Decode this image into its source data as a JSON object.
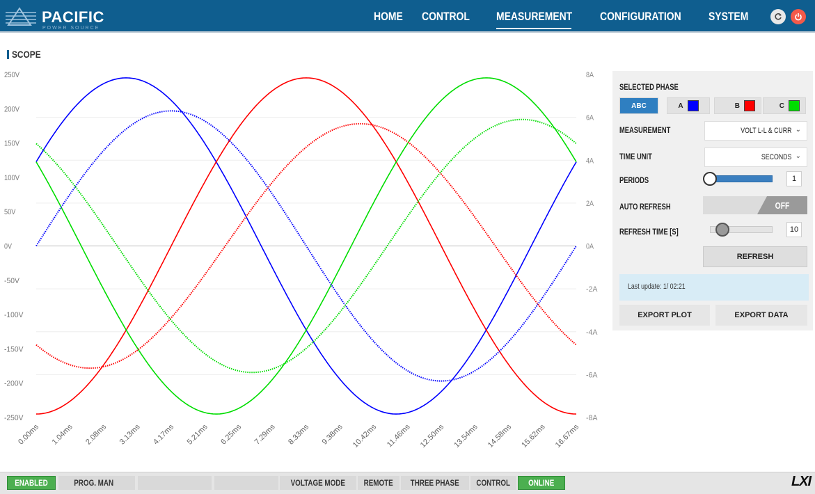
{
  "header": {
    "brand": "PACIFIC",
    "brand_sub": "POWER SOURCE",
    "nav": [
      "HOME",
      "CONTROL",
      "MEASUREMENT",
      "CONFIGURATION",
      "SYSTEM"
    ],
    "active_nav": "MEASUREMENT",
    "icons": [
      "refresh-icon",
      "power-icon"
    ]
  },
  "page": {
    "title": "SCOPE"
  },
  "chart_data": {
    "type": "line",
    "x_label": "",
    "x_ticks": [
      "0.00ms",
      "1.04ms",
      "2.08ms",
      "3.13ms",
      "4.17ms",
      "5.21ms",
      "6.25ms",
      "7.29ms",
      "8.33ms",
      "9.38ms",
      "10.42ms",
      "11.46ms",
      "12.50ms",
      "13.54ms",
      "14.58ms",
      "15.62ms",
      "16.67ms"
    ],
    "x_range_ms": [
      0,
      16.67
    ],
    "y_left_ticks": [
      "250V",
      "200V",
      "150V",
      "100V",
      "50V",
      "0V",
      "-50V",
      "-100V",
      "-150V",
      "-200V",
      "-250V"
    ],
    "y_left_range": [
      -250,
      250
    ],
    "y_right_ticks": [
      "8A",
      "6A",
      "4A",
      "2A",
      "0A",
      "-2A",
      "-4A",
      "-6A",
      "-8A"
    ],
    "y_right_range": [
      -8,
      8
    ],
    "grid": "horizontal",
    "series": [
      {
        "phase": "A",
        "kind": "voltage",
        "color": "#0000ff",
        "amplitude_V": 245,
        "phase_deg": 30,
        "style": "solid"
      },
      {
        "phase": "B",
        "kind": "voltage",
        "color": "#ff0000",
        "amplitude_V": 245,
        "phase_deg": -90,
        "style": "solid"
      },
      {
        "phase": "C",
        "kind": "voltage",
        "color": "#00dd00",
        "amplitude_V": 245,
        "phase_deg": 150,
        "style": "solid"
      },
      {
        "phase": "A",
        "kind": "current",
        "color": "#0000ff",
        "amplitude_A": 6.3,
        "phase_deg": 0,
        "style": "dotted"
      },
      {
        "phase": "B",
        "kind": "current",
        "color": "#ff0000",
        "amplitude_A": 5.7,
        "phase_deg": -126,
        "style": "dotted"
      },
      {
        "phase": "C",
        "kind": "current",
        "color": "#00dd00",
        "amplitude_A": 5.9,
        "phase_deg": 126,
        "style": "dotted"
      }
    ]
  },
  "panel": {
    "selected_phase_label": "SELECTED PHASE",
    "phase_buttons": [
      {
        "label": "ABC",
        "color": ""
      },
      {
        "label": "A",
        "color": "#0000ff"
      },
      {
        "label": "B",
        "color": "#ff0000"
      },
      {
        "label": "C",
        "color": "#00dd00"
      }
    ],
    "measurement_label": "MEASUREMENT",
    "measurement_value": "VOLT L-L & CURR",
    "time_unit_label": "TIME UNIT",
    "time_unit_value": "SECONDS",
    "periods_label": "PERIODS",
    "periods_value": "1",
    "periods_fraction": 0,
    "auto_refresh_label": "AUTO REFRESH",
    "auto_refresh_value": "OFF",
    "refresh_time_label": "REFRESH TIME [S]",
    "refresh_time_value": "10",
    "refresh_time_fraction": 0.27,
    "refresh_button": "REFRESH",
    "last_update": "Last update: 1/ 02:21",
    "export_plot": "EXPORT PLOT",
    "export_data": "EXPORT DATA"
  },
  "status": {
    "items": [
      "ENABLED",
      "PROG. MAN",
      "",
      "",
      "VOLTAGE MODE",
      "REMOTE",
      "THREE PHASE",
      "CONTROL",
      "ONLINE"
    ],
    "green_color": "#4caf50",
    "logo": "LXI"
  }
}
